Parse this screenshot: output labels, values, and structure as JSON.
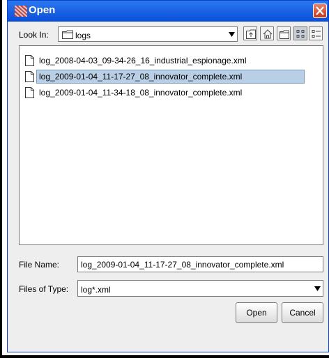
{
  "window": {
    "title": "Open"
  },
  "look_in": {
    "label": "Look In:",
    "value": "logs"
  },
  "toolbar": {
    "buttons": [
      "up-one-level-icon",
      "home-icon",
      "new-folder-icon",
      "list-view-icon",
      "details-view-icon"
    ]
  },
  "files": [
    {
      "name": "log_2008-04-03_09-34-26_16_industrial_espionage.xml"
    },
    {
      "name": "log_2009-01-04_11-17-27_08_innovator_complete.xml",
      "selected": true
    },
    {
      "name": "log_2009-01-04_11-34-18_08_innovator_complete.xml"
    }
  ],
  "file_name": {
    "label": "File Name:",
    "value": "log_2009-01-04_11-17-27_08_innovator_complete.xml"
  },
  "file_type": {
    "label": "Files of Type:",
    "value": "log*.xml"
  },
  "buttons": {
    "open": "Open",
    "cancel": "Cancel"
  },
  "colors": {
    "titlebar": "#0a4fd9",
    "selection": "#b8cfe5",
    "close_button": "#c2391b"
  }
}
